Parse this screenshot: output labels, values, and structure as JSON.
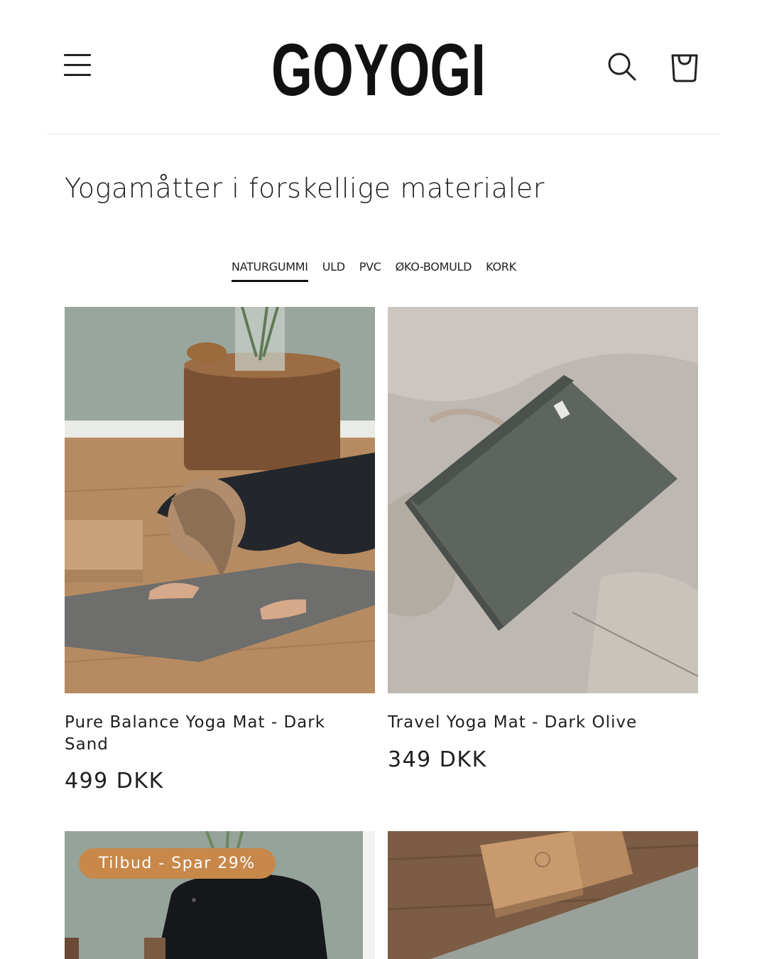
{
  "header": {
    "logo_text": "GOYOGI",
    "menu_icon": "hamburger-menu-icon",
    "search_icon": "search-icon",
    "cart_icon": "cart-icon"
  },
  "page": {
    "title": "Yogamåtter i forskellige materialer"
  },
  "tabs": [
    {
      "label": "NATURGUMMI",
      "active": true
    },
    {
      "label": "ULD",
      "active": false
    },
    {
      "label": "PVC",
      "active": false
    },
    {
      "label": "ØKO-BOMULD",
      "active": false
    },
    {
      "label": "KORK",
      "active": false
    }
  ],
  "products": [
    {
      "title": "Pure Balance Yoga Mat - Dark Sand",
      "price": "499 DKK"
    },
    {
      "title": "Travel Yoga Mat - Dark Olive",
      "price": "349 DKK"
    },
    {
      "badge": "Tilbud - Spar 29%"
    },
    {}
  ],
  "colors": {
    "badge_bg": "#c7884a",
    "text": "#1a1a1a",
    "divider": "#efefef"
  }
}
